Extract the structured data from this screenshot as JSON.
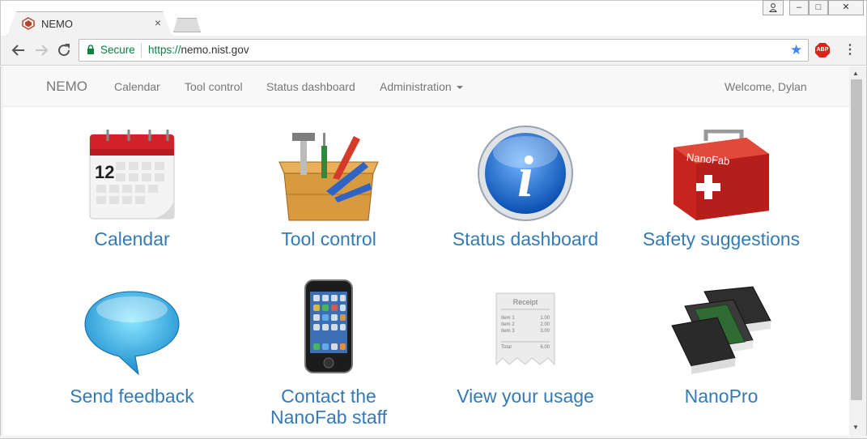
{
  "browser": {
    "tab_title": "NEMO",
    "tab_close": "×",
    "window_user": "⌂",
    "window_min": "–",
    "window_max": "□",
    "window_close": "✕",
    "security_label": "Secure",
    "url_scheme": "https://",
    "url_host": "nemo.nist.gov",
    "bookmark_icon": "★",
    "adblock_label": "ABP",
    "menu_icon": "⋮"
  },
  "navbar": {
    "brand": "NEMO",
    "links": [
      "Calendar",
      "Tool control",
      "Status dashboard",
      "Administration"
    ],
    "welcome": "Welcome, Dylan"
  },
  "tiles": [
    {
      "label": "Calendar",
      "icon": "calendar-icon",
      "calendar_day": "12"
    },
    {
      "label": "Tool control",
      "icon": "toolbox-icon"
    },
    {
      "label": "Status dashboard",
      "icon": "info-icon",
      "glyph": "i"
    },
    {
      "label": "Safety suggestions",
      "icon": "first-aid-kit-icon",
      "kit_text": "NanoFab"
    },
    {
      "label": "Send feedback",
      "icon": "speech-bubble-icon"
    },
    {
      "label_line1": "Contact the",
      "label_line2": "NanoFab staff",
      "icon": "phone-icon"
    },
    {
      "label": "View your usage",
      "icon": "receipt-icon",
      "receipt": {
        "title": "Receipt",
        "items": [
          "Item 1",
          "Item 2",
          "Item 3"
        ],
        "amounts": [
          "1.00",
          "2.00",
          "3.00"
        ],
        "total_label": "Total",
        "total": "6.00"
      }
    },
    {
      "label": "NanoPro",
      "icon": "books-icon"
    }
  ],
  "colors": {
    "link": "#337ab7",
    "navbar_bg": "#f8f8f8",
    "navbar_text": "#777777",
    "secure_green": "#0b8043"
  }
}
